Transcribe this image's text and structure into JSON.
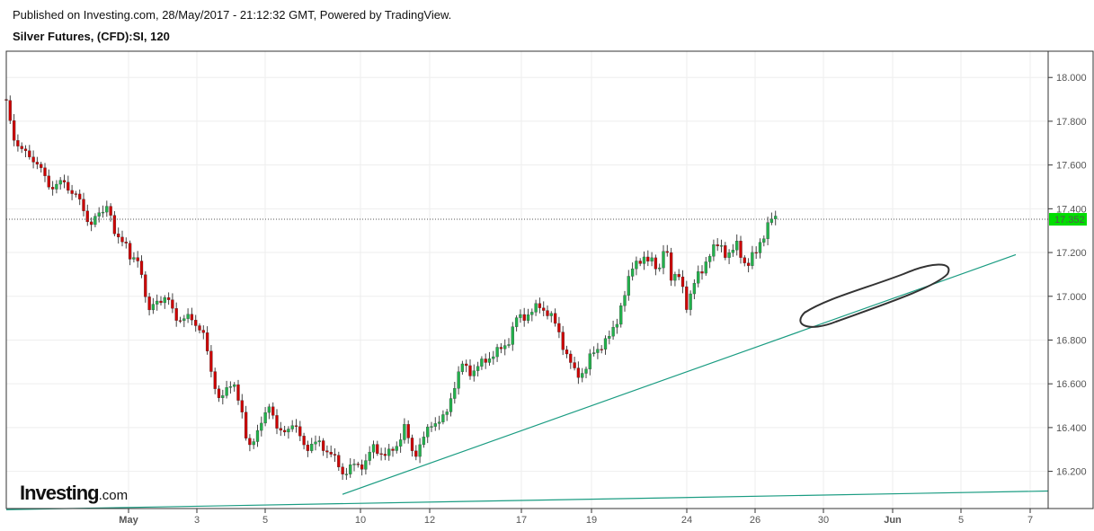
{
  "header": {
    "published": "Published on Investing.com, 28/May/2017 - 21:12:32 GMT, Powered by TradingView.",
    "title": "Silver Futures, (CFD):SI, 120"
  },
  "logo": {
    "main": "Investing",
    "suffix": ".com"
  },
  "colors": {
    "up": "#22b14c",
    "down": "#cc0000",
    "wick": "#444444",
    "trend": "#1a9c82",
    "price_label": "#00dd00"
  },
  "chart_data": {
    "type": "candlestick",
    "title": "Silver Futures, (CFD):SI, 120",
    "ylim": [
      16.03,
      18.12
    ],
    "xlim": [
      0,
      115.9
    ],
    "y_ticks": [
      "18.000",
      "17.800",
      "17.600",
      "17.400",
      "17.200",
      "17.000",
      "16.800",
      "16.600",
      "16.400",
      "16.200"
    ],
    "x_ticks": [
      {
        "label": "May",
        "t": 13.6
      },
      {
        "label": "3",
        "t": 21.2
      },
      {
        "label": "5",
        "t": 28.8
      },
      {
        "label": "10",
        "t": 39.4
      },
      {
        "label": "12",
        "t": 47.1
      },
      {
        "label": "17",
        "t": 57.3
      },
      {
        "label": "19",
        "t": 65.1
      },
      {
        "label": "24",
        "t": 75.7
      },
      {
        "label": "26",
        "t": 83.3
      },
      {
        "label": "30",
        "t": 90.9
      },
      {
        "label": "Jun",
        "t": 98.6
      },
      {
        "label": "5",
        "t": 106.2
      },
      {
        "label": "7",
        "t": 113.9
      }
    ],
    "grid": true,
    "last_price": 17.352,
    "last_price_label": "17.352",
    "closes": [
      [
        0,
        17.88
      ],
      [
        0.8,
        17.73
      ],
      [
        1.8,
        17.66
      ],
      [
        3.3,
        17.62
      ],
      [
        4.8,
        17.5
      ],
      [
        6.3,
        17.52
      ],
      [
        7.8,
        17.46
      ],
      [
        9.3,
        17.33
      ],
      [
        10.8,
        17.39
      ],
      [
        11.3,
        17.44
      ],
      [
        12.1,
        17.26
      ],
      [
        13.3,
        17.26
      ],
      [
        13.8,
        17.16
      ],
      [
        14.8,
        17.16
      ],
      [
        15.3,
        17.06
      ],
      [
        15.8,
        16.92
      ],
      [
        16.8,
        16.98
      ],
      [
        17.8,
        17.0
      ],
      [
        18.8,
        16.9
      ],
      [
        20.3,
        16.9
      ],
      [
        21.8,
        16.85
      ],
      [
        22.8,
        16.65
      ],
      [
        23.8,
        16.52
      ],
      [
        25.3,
        16.62
      ],
      [
        26.3,
        16.44
      ],
      [
        26.8,
        16.31
      ],
      [
        28.3,
        16.4
      ],
      [
        29.3,
        16.52
      ],
      [
        30.3,
        16.36
      ],
      [
        31.8,
        16.42
      ],
      [
        33.3,
        16.31
      ],
      [
        34.8,
        16.33
      ],
      [
        36.3,
        16.27
      ],
      [
        37.5,
        16.19
      ],
      [
        38.8,
        16.23
      ],
      [
        39.8,
        16.23
      ],
      [
        40.8,
        16.31
      ],
      [
        42.3,
        16.27
      ],
      [
        43.3,
        16.31
      ],
      [
        44.3,
        16.4
      ],
      [
        45.3,
        16.27
      ],
      [
        46.3,
        16.34
      ],
      [
        47.3,
        16.42
      ],
      [
        48.8,
        16.44
      ],
      [
        49.8,
        16.59
      ],
      [
        50.8,
        16.69
      ],
      [
        51.8,
        16.65
      ],
      [
        53.3,
        16.71
      ],
      [
        54.8,
        16.75
      ],
      [
        55.8,
        16.79
      ],
      [
        56.8,
        16.9
      ],
      [
        58.3,
        16.92
      ],
      [
        59.3,
        16.96
      ],
      [
        60.3,
        16.92
      ],
      [
        61.3,
        16.86
      ],
      [
        62.3,
        16.73
      ],
      [
        63.3,
        16.65
      ],
      [
        64.3,
        16.65
      ],
      [
        65.3,
        16.75
      ],
      [
        66.8,
        16.79
      ],
      [
        67.8,
        16.88
      ],
      [
        68.8,
        17.0
      ],
      [
        69.8,
        17.17
      ],
      [
        70.8,
        17.15
      ],
      [
        71.8,
        17.18
      ],
      [
        72.8,
        17.1
      ],
      [
        73.3,
        17.27
      ],
      [
        73.8,
        17.1
      ],
      [
        74.8,
        17.09
      ],
      [
        75.8,
        16.94
      ],
      [
        76.3,
        17.06
      ],
      [
        77.3,
        17.1
      ],
      [
        78.3,
        17.21
      ],
      [
        79.3,
        17.23
      ],
      [
        80.3,
        17.19
      ],
      [
        81.3,
        17.23
      ],
      [
        82.3,
        17.14
      ],
      [
        83.3,
        17.19
      ],
      [
        84.3,
        17.29
      ],
      [
        85.1,
        17.35
      ],
      [
        85.8,
        17.352
      ]
    ],
    "trendlines": [
      [
        [
          37.4,
          16.095
        ],
        [
          112.3,
          17.19
        ]
      ],
      [
        [
          0,
          16.025
        ],
        [
          115.9,
          16.11
        ]
      ]
    ]
  }
}
